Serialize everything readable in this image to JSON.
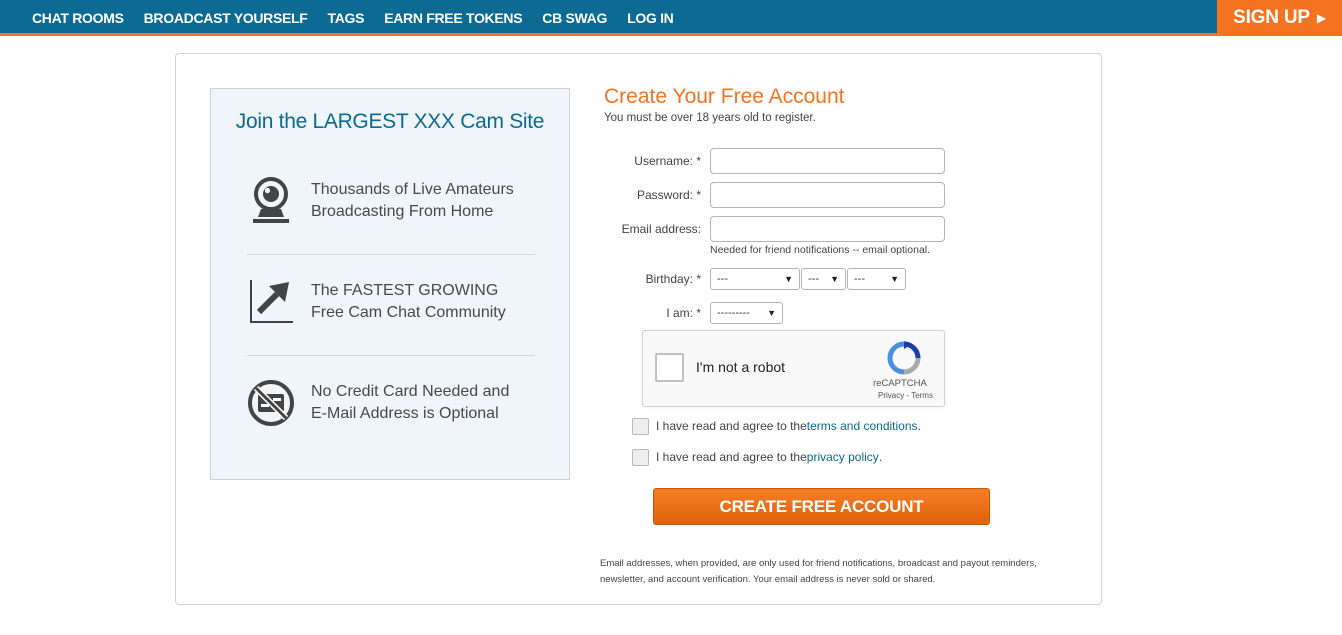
{
  "nav": {
    "items": [
      "CHAT ROOMS",
      "BROADCAST YOURSELF",
      "TAGS",
      "EARN FREE TOKENS",
      "CB SWAG",
      "LOG IN"
    ],
    "signup_label": "SIGN UP",
    "signup_arrow": "▶"
  },
  "promo": {
    "title": "Join the LARGEST XXX Cam Site",
    "features": [
      {
        "icon": "webcam-icon",
        "line1": "Thousands of Live Amateurs",
        "line2": "Broadcasting From Home"
      },
      {
        "icon": "growth-arrow-icon",
        "line1": "The FASTEST GROWING",
        "line2": "Free Cam Chat Community"
      },
      {
        "icon": "no-credit-card-icon",
        "line1": "No Credit Card Needed and",
        "line2": "E-Mail Address is Optional"
      }
    ]
  },
  "form": {
    "title": "Create Your Free Account",
    "subtitle": "You must be over 18 years old to register.",
    "username_label": "Username: *",
    "password_label": "Password: *",
    "email_label": "Email address:",
    "email_hint": "Needed for friend notifications -- email optional.",
    "birthday_label": "Birthday: *",
    "birthday_month": "---",
    "birthday_day": "---",
    "birthday_year": "---",
    "iam_label": "I am: *",
    "iam_value": "---------",
    "caret": "▼",
    "captcha": {
      "label": "I'm not a robot",
      "brand": "reCAPTCHA",
      "links": "Privacy - Terms"
    },
    "terms_prefix": "I have read and agree to the ",
    "terms_link": "terms and conditions",
    "privacy_prefix": "I have read and agree to the ",
    "privacy_link": "privacy policy",
    "period": ".",
    "submit_label": "CREATE FREE ACCOUNT",
    "disclaimer": "Email addresses, when provided, are only used for friend notifications, broadcast and payout reminders, newsletter, and account verification. Your email address is never sold or shared."
  },
  "colors": {
    "brand_blue": "#0c6a93",
    "brand_orange": "#f47321"
  }
}
